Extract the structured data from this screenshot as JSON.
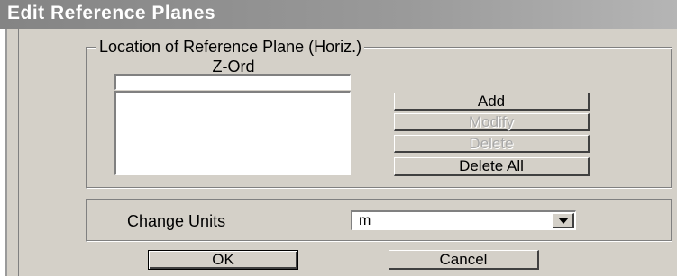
{
  "window": {
    "title": "Edit Reference Planes"
  },
  "group": {
    "legend": "Location of Reference Plane (Horiz.)",
    "column_label": "Z-Ord",
    "z_ord_value": "",
    "list_items": []
  },
  "buttons": {
    "add": "Add",
    "modify": "Modify",
    "delete": "Delete",
    "delete_all": "Delete All",
    "ok": "OK",
    "cancel": "Cancel"
  },
  "units": {
    "label": "Change Units",
    "selected": "m"
  },
  "icons": {
    "dropdown": "chevron-down-icon"
  }
}
